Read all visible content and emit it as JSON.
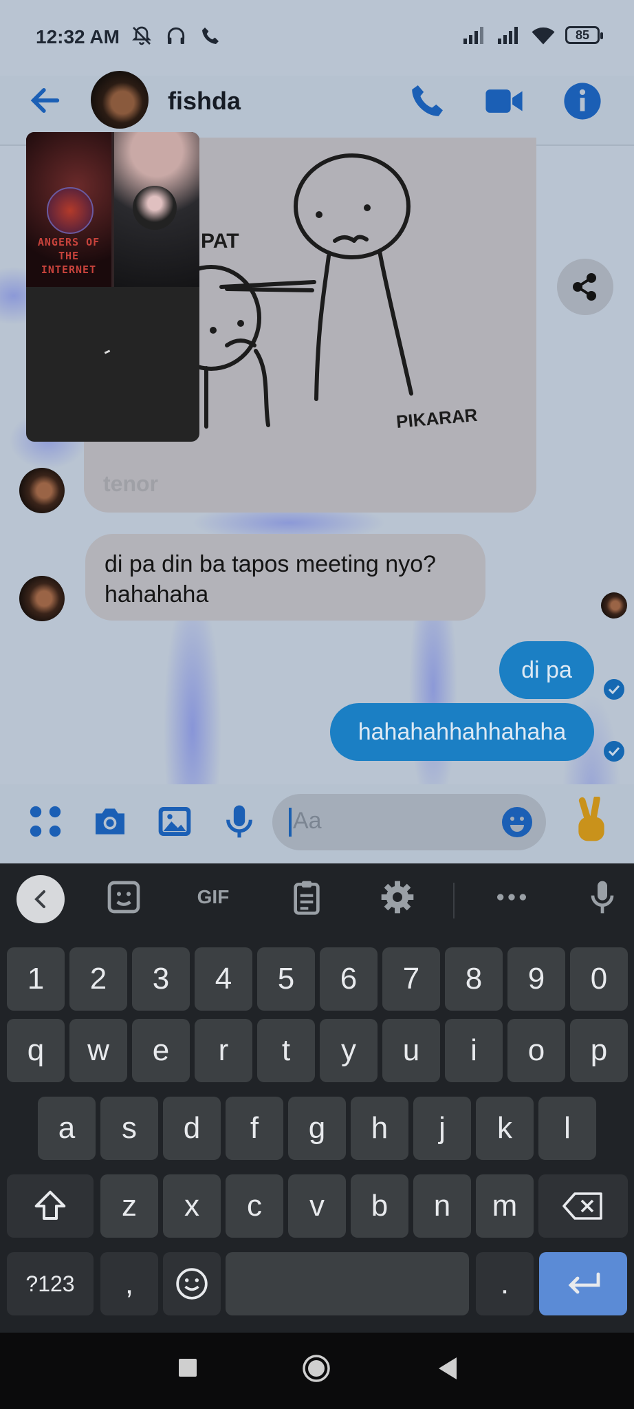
{
  "status_bar": {
    "time": "12:32 AM",
    "battery": "85"
  },
  "header": {
    "contact_name": "fishda"
  },
  "pip": {
    "title_line1": "ANGERS OF THE",
    "title_line2": "INTERNET"
  },
  "gif": {
    "label_pat": "PAT",
    "label_pikarar": "PIKARAR",
    "watermark": "tenor"
  },
  "messages": [
    {
      "from": "them",
      "text_line1": "di pa din ba tapos meeting nyo?",
      "text_line2": "hahahaha"
    },
    {
      "from": "me",
      "text": "di pa"
    },
    {
      "from": "me",
      "text": "hahahahhahhahaha"
    }
  ],
  "composer": {
    "placeholder": "Aa"
  },
  "keyboard": {
    "gif_label": "GIF",
    "row_numbers": [
      "1",
      "2",
      "3",
      "4",
      "5",
      "6",
      "7",
      "8",
      "9",
      "0"
    ],
    "row_1": [
      "q",
      "w",
      "e",
      "r",
      "t",
      "y",
      "u",
      "i",
      "o",
      "p"
    ],
    "row_2": [
      "a",
      "s",
      "d",
      "f",
      "g",
      "h",
      "j",
      "k",
      "l"
    ],
    "row_3": [
      "z",
      "x",
      "c",
      "v",
      "b",
      "n",
      "m"
    ],
    "symbols_label": "?123",
    "comma": ",",
    "period": "."
  },
  "colors": {
    "accent": "#1b5fb5",
    "outgoing_bubble": "#1b7fc4",
    "keyboard_bg": "#202327"
  }
}
